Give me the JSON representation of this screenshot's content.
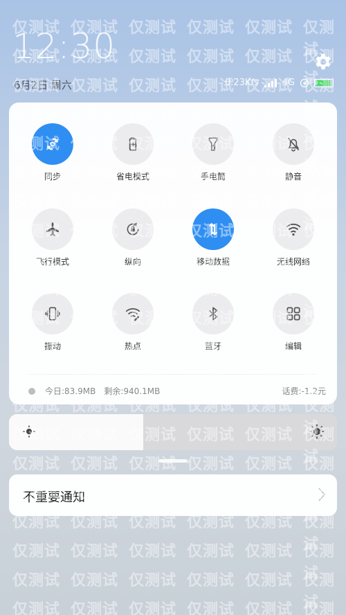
{
  "status": {
    "time": "12:30",
    "date": "6月2日 周六",
    "net_speed": "0.23K/s",
    "network": "4G",
    "battery_color": "#4cd964",
    "battery_level": 0.9
  },
  "tiles": [
    {
      "label": "同步",
      "icon": "sync-icon",
      "on": true
    },
    {
      "label": "省电模式",
      "icon": "battery-saver-icon",
      "on": false
    },
    {
      "label": "手电筒",
      "icon": "flashlight-icon",
      "on": false
    },
    {
      "label": "静音",
      "icon": "bell-muted-icon",
      "on": false
    },
    {
      "label": "飞行模式",
      "icon": "airplane-icon",
      "on": false
    },
    {
      "label": "纵向",
      "icon": "rotation-lock-icon",
      "on": false
    },
    {
      "label": "移动数据",
      "icon": "mobile-data-icon",
      "on": true
    },
    {
      "label": "无线网络",
      "icon": "wifi-icon",
      "on": false
    },
    {
      "label": "振动",
      "icon": "vibrate-icon",
      "on": false
    },
    {
      "label": "热点",
      "icon": "hotspot-icon",
      "on": false
    },
    {
      "label": "蓝牙",
      "icon": "bluetooth-icon",
      "on": false
    },
    {
      "label": "编辑",
      "icon": "grid-edit-icon",
      "on": false
    }
  ],
  "data_usage": {
    "today": "今日:83.9MB",
    "remaining": "剩余:940.1MB",
    "balance": "话费:-1.2元"
  },
  "brightness": {
    "level": 0.41
  },
  "notification": {
    "title": "不重要通知"
  },
  "accent": "#2f8ef2",
  "watermark_text": "仅测试"
}
